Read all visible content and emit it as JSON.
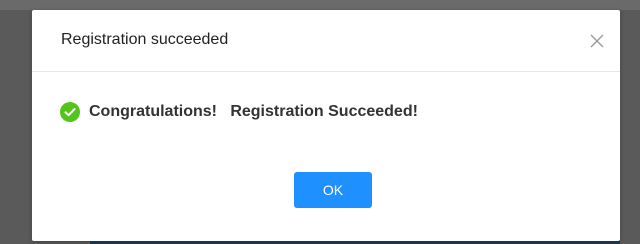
{
  "dialog": {
    "title": "Registration succeeded",
    "close_icon": "close-icon",
    "message": "Congratulations!   Registration Succeeded!",
    "status_icon": "check-circle-icon",
    "ok_label": "OK"
  },
  "colors": {
    "accent": "#1e90ff",
    "success": "#52c41a",
    "backdrop": "#5a5a5a"
  }
}
